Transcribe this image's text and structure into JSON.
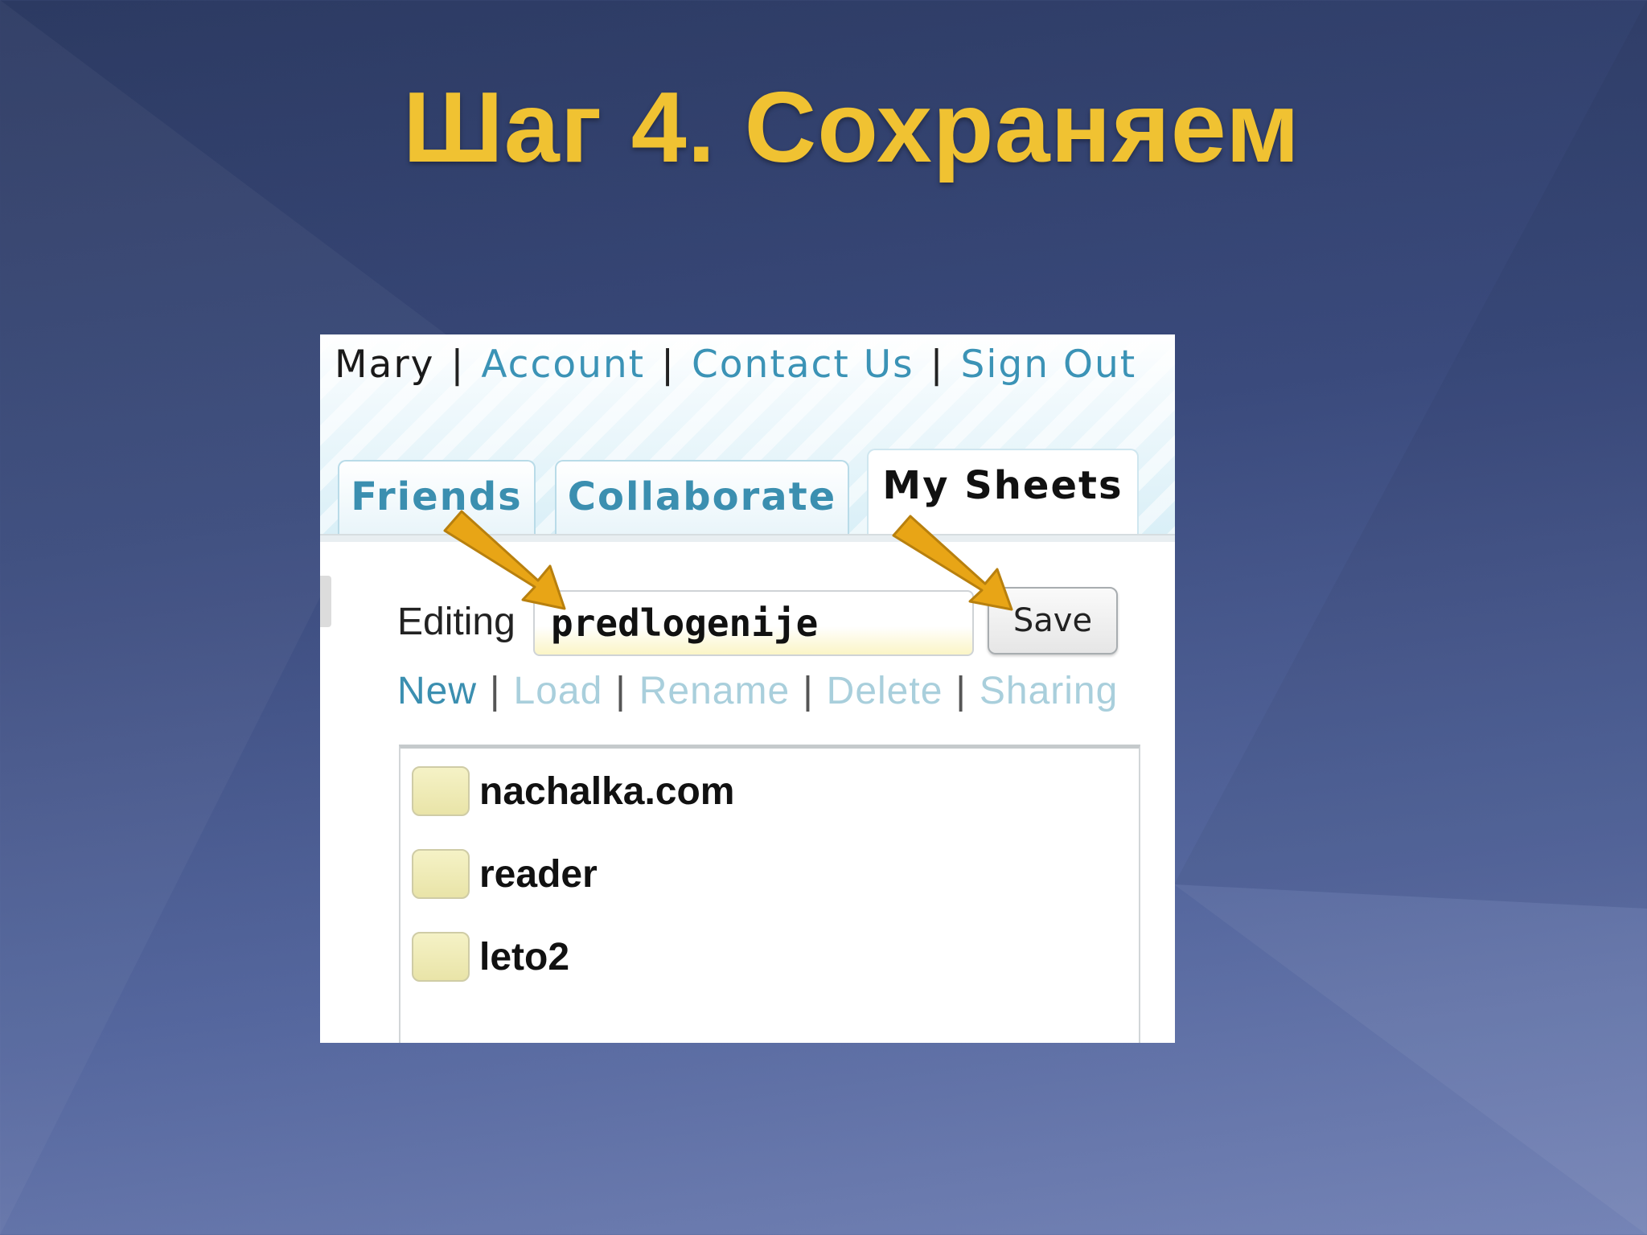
{
  "slide": {
    "title": "Шаг 4. Сохраняем"
  },
  "user_nav": {
    "user_name": "Mary",
    "separator": "|",
    "links": [
      "Account",
      "Contact Us",
      "Sign Out"
    ]
  },
  "tabs": [
    {
      "label": "Friends",
      "active": false
    },
    {
      "label": "Collaborate",
      "active": false
    },
    {
      "label": "My Sheets",
      "active": true
    }
  ],
  "editor": {
    "editing_label": "Editing",
    "sheet_name_value": "predlogenije",
    "save_label": "Save"
  },
  "actions": {
    "new": "New",
    "load": "Load",
    "rename": "Rename",
    "delete": "Delete",
    "sharing": "Sharing",
    "separator": "|"
  },
  "files": [
    {
      "name": "nachalka.com"
    },
    {
      "name": "reader"
    },
    {
      "name": "leto2"
    }
  ],
  "colors": {
    "title": "#f0c232",
    "link": "#3b93b6",
    "disabled_link": "#a9cfdc",
    "arrow": "#e8a516"
  }
}
